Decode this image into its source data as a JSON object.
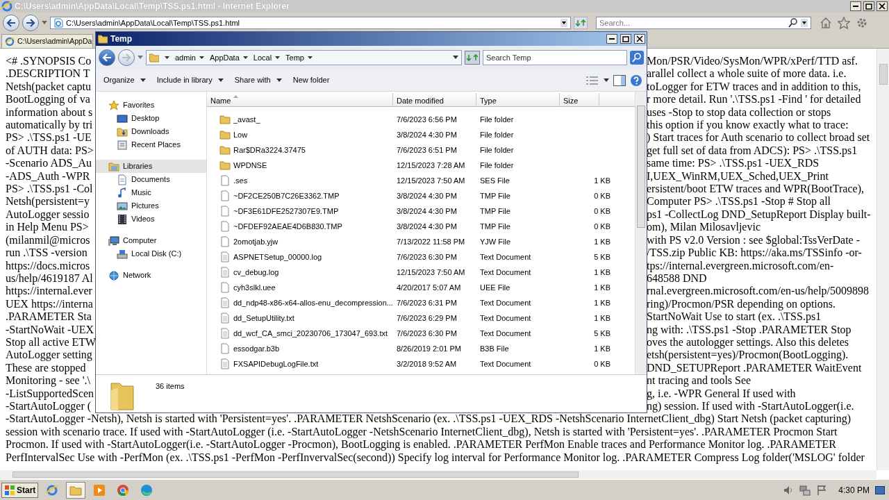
{
  "browser": {
    "title": "C:\\Users\\admin\\AppData\\Local\\Temp\\TSS.ps1.html - Internet Explorer",
    "address": "C:\\Users\\admin\\AppData\\Local\\Temp\\TSS.ps1.html",
    "search_placeholder": "Search...",
    "tab": "C:\\Users\\admin\\AppDa"
  },
  "page_lines": [
    {
      "left": "<# .SYNOPSIS Co",
      "right": "Mon/PSR/Video/SysMon/WPR/xPerf/TTD asf."
    },
    {
      "left": ".DESCRIPTION T",
      "right": "arallel collect a whole suite of more data. i.e."
    },
    {
      "left": "Netsh(packet captu",
      "right": "toLogger for ETW traces and in addition to this,"
    },
    {
      "left": "BootLogging of va",
      "right": "r more detail. Run '.\\TSS.ps1 -Find ' for detailed"
    },
    {
      "left": "information about s",
      "right": "uses -Stop to stop data collection or stops"
    },
    {
      "left": "automatically by tri",
      "right": "this option if you know exactly what to trace:"
    },
    {
      "left": "PS> .\\TSS.ps1 -UE",
      "right": ") Start traces for Auth scenario to collect broad set"
    },
    {
      "left": "of AUTH data: PS>",
      "right": "get full set of data from ADCS): PS> .\\TSS.ps1"
    },
    {
      "left": "-Scenario ADS_Au",
      "right": "same time: PS> .\\TSS.ps1 -UEX_RDS"
    },
    {
      "left": "-ADS_Auth -WPR",
      "right": "I,UEX_WinRM,UEX_Sched,UEX_Print"
    },
    {
      "left": "PS> .\\TSS.ps1 -Col",
      "right": "ersistent/boot ETW traces and WPR(BootTrace),"
    },
    {
      "left": "Netsh(persistent=y",
      "right": "Computer PS> .\\TSS.ps1 -Stop # Stop all"
    },
    {
      "left": "AutoLogger sessio",
      "right": "ps1 -CollectLog DND_SetupReport Display built-"
    },
    {
      "left": "in Help Menu PS>",
      "right": "om), Milan Milosavljevic"
    },
    {
      "left": "(milanmil@micros",
      "right": "with PS v2.0 Version : see $global:TssVerDate -"
    },
    {
      "left": "run .\\TSS -version",
      "right": "/TSS.zip Public KB: https://aka.ms/TSSinfo -or-"
    },
    {
      "left": "https://docs.micros",
      "right": "tps://internal.evergreen.microsoft.com/en-"
    },
    {
      "left": "us/help/4619187 Al",
      "right": "648588 DND"
    },
    {
      "left": "https://internal.ever",
      "right": "rnal.evergreen.microsoft.com/en-us/help/5009898"
    },
    {
      "left": "UEX https://interna",
      "right": "ring)/Procmon/PSR depending on options."
    },
    {
      "left": ".PARAMETER Sta",
      "right": "StartNoWait Use to start (ex. .\\TSS.ps1"
    },
    {
      "left": "-StartNoWait -UEX",
      "right": "ng with: .\\TSS.ps1 -Stop .PARAMETER Stop"
    },
    {
      "left": "Stop all active ETW",
      "right": "oves the autologger settings. Also this deletes"
    },
    {
      "left": "AutoLogger setting",
      "right": "etsh(persistent=yes)/Procmon(BootLogging)."
    },
    {
      "left": "These are stopped",
      "right": "DND_SETUPReport .PARAMETER WaitEvent"
    },
    {
      "left": "Monitoring - see '.\\",
      "right": "nt tracing and tools See"
    },
    {
      "left": "-ListSupportedScen",
      "right": "g, i.e. -WPR General If used with"
    },
    {
      "left": "-StartAutoLogger (",
      "right": "ng) session. If used with -StartAutoLogger(i.e."
    }
  ],
  "page_full_lines": [
    "-StartAutoLogger -Netsh), Netsh is started with 'Persistent=yes'. .PARAMETER NetshScenario (ex. .\\TSS.ps1 -UEX_RDS -NetshScenario InternetClient_dbg) Start Netsh (packet capturing)",
    "session with scenario trace. If used with -StartAutoLogger (i.e. -StartAutoLogger -NetshScenario InternetClient_dbg), Netsh is started with 'Persistent=yes'. .PARAMETER Procmon Start",
    "Procmon. If used with -StartAutoLogger(i.e. -StartAutoLogger -Procmon), BootLogging is enabled. .PARAMETER PerfMon Enable traces and Performance Monitor log. .PARAMETER",
    "PerfIntervalSec Use with -PerfMon (ex. .\\TSS.ps1 -PerfMon -PerfInvervalSec(second)) Specify log interval for Performance Monitor log. .PARAMETER Compress Log folder('MSLOG' folder"
  ],
  "explorer": {
    "title": "Temp",
    "breadcrumb": [
      "admin",
      "AppData",
      "Local",
      "Temp"
    ],
    "search_placeholder": "Search Temp",
    "toolbar": [
      {
        "label": "Organize",
        "menu": true
      },
      {
        "label": "Include in library",
        "menu": true
      },
      {
        "label": "Share with",
        "menu": true
      },
      {
        "label": "New folder",
        "menu": false
      }
    ],
    "nav": [
      {
        "label": "Favorites",
        "kind": "star",
        "selected": false,
        "children": [
          {
            "label": "Desktop",
            "kind": "desktop",
            "selected": false
          },
          {
            "label": "Downloads",
            "kind": "download",
            "selected": false
          },
          {
            "label": "Recent Places",
            "kind": "recent",
            "selected": false
          }
        ]
      },
      {
        "label": "Libraries",
        "kind": "library",
        "selected": true,
        "children": [
          {
            "label": "Documents",
            "kind": "document",
            "selected": false
          },
          {
            "label": "Music",
            "kind": "music",
            "selected": false
          },
          {
            "label": "Pictures",
            "kind": "picture",
            "selected": false
          },
          {
            "label": "Videos",
            "kind": "video",
            "selected": false
          }
        ]
      },
      {
        "label": "Computer",
        "kind": "computer",
        "selected": false,
        "children": [
          {
            "label": "Local Disk (C:)",
            "kind": "disk",
            "selected": false
          }
        ]
      },
      {
        "label": "Network",
        "kind": "network",
        "selected": false
      }
    ],
    "columns": [
      {
        "label": "Name",
        "sorted": true
      },
      {
        "label": "Date modified",
        "sorted": false
      },
      {
        "label": "Type",
        "sorted": false
      },
      {
        "label": "Size",
        "sorted": false
      }
    ],
    "rows": [
      {
        "kind": "folder",
        "name": "_avast_",
        "date": "7/6/2023 6:56 PM",
        "type": "File folder"
      },
      {
        "kind": "folder",
        "name": "Low",
        "date": "3/8/2024 4:30 PM",
        "type": "File folder"
      },
      {
        "kind": "folder",
        "name": "Rar$DRa3224.37475",
        "date": "7/6/2023 6:51 PM",
        "type": "File folder"
      },
      {
        "kind": "folder",
        "name": "WPDNSE",
        "date": "12/15/2023 7:28 AM",
        "type": "File folder"
      },
      {
        "kind": "file",
        "name": ".ses",
        "date": "12/15/2023 7:50 AM",
        "type": "SES File",
        "size": "1 KB"
      },
      {
        "kind": "file",
        "name": "~DF2CE250B7C26E3362.TMP",
        "date": "3/8/2024 4:30 PM",
        "type": "TMP File",
        "size": "0 KB"
      },
      {
        "kind": "file",
        "name": "~DF3E61DFE2527307E9.TMP",
        "date": "3/8/2024 4:30 PM",
        "type": "TMP File",
        "size": "0 KB"
      },
      {
        "kind": "file",
        "name": "~DFDEF92AEAE4D6B830.TMP",
        "date": "3/8/2024 4:30 PM",
        "type": "TMP File",
        "size": "0 KB"
      },
      {
        "kind": "file",
        "name": "2omotjab.yjw",
        "date": "7/13/2022 11:58 PM",
        "type": "YJW File",
        "size": "1 KB"
      },
      {
        "kind": "document",
        "name": "ASPNETSetup_00000.log",
        "date": "7/6/2023 6:30 PM",
        "type": "Text Document",
        "size": "5 KB"
      },
      {
        "kind": "document",
        "name": "cv_debug.log",
        "date": "12/15/2023 7:50 AM",
        "type": "Text Document",
        "size": "1 KB"
      },
      {
        "kind": "file",
        "name": "cyh3slkl.uee",
        "date": "4/20/2017 5:07 AM",
        "type": "UEE File",
        "size": "1 KB"
      },
      {
        "kind": "document",
        "name": "dd_ndp48-x86-x64-allos-enu_decompression...",
        "date": "7/6/2023 6:31 PM",
        "type": "Text Document",
        "size": "1 KB"
      },
      {
        "kind": "document",
        "name": "dd_SetupUtility.txt",
        "date": "7/6/2023 6:29 PM",
        "type": "Text Document",
        "size": "1 KB"
      },
      {
        "kind": "document",
        "name": "dd_wcf_CA_smci_20230706_173047_693.txt",
        "date": "7/6/2023 6:30 PM",
        "type": "Text Document",
        "size": "5 KB"
      },
      {
        "kind": "file",
        "name": "essodgar.b3b",
        "date": "8/26/2019 2:01 PM",
        "type": "B3B File",
        "size": "1 KB"
      },
      {
        "kind": "document",
        "name": "FXSAPIDebugLogFile.txt",
        "date": "3/2/2018 9:52 AM",
        "type": "Text Document",
        "size": "0 KB"
      }
    ],
    "status": "36 items"
  },
  "taskbar": {
    "start": "Start",
    "apps": [
      {
        "kind": "ie",
        "active": false
      },
      {
        "kind": "explorer",
        "active": true
      },
      {
        "kind": "media",
        "active": false
      },
      {
        "kind": "chrome",
        "active": false
      },
      {
        "kind": "edge",
        "active": false
      }
    ],
    "clock": "4:30 PM"
  }
}
